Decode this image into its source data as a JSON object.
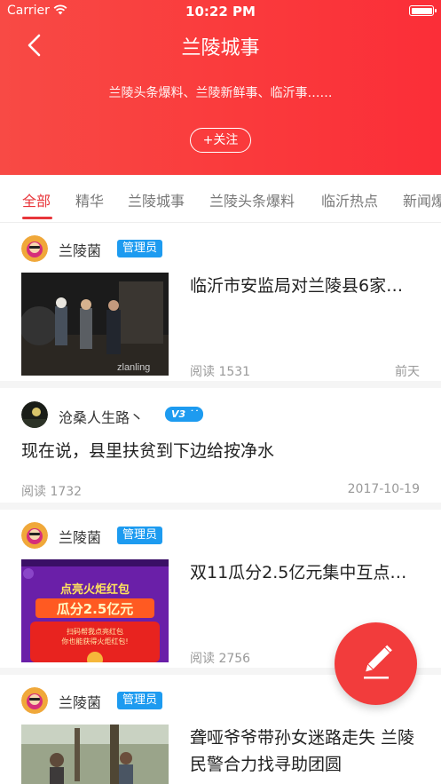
{
  "status_bar": {
    "carrier": "Carrier",
    "time": "10:22 PM"
  },
  "header": {
    "title": "兰陵城事",
    "subtitle": "兰陵头条爆料、兰陵新鲜事、临沂事……",
    "follow_label": "+关注"
  },
  "tabs": [
    "全部",
    "精华",
    "兰陵城事",
    "兰陵头条爆料",
    "临沂热点",
    "新闻爆"
  ],
  "posts": [
    {
      "author": "兰陵菌",
      "badge": "管理员",
      "title": "临沂市安监局对兰陵县6家…",
      "reads": "阅读 1531",
      "time": "前天",
      "watermark": "zlanling"
    },
    {
      "author": "沧桑人生路丶",
      "badge": "V3",
      "title": "现在说，县里扶贫到下边给按净水",
      "reads": "阅读 1732",
      "time": "2017-10-19"
    },
    {
      "author": "兰陵菌",
      "badge": "管理员",
      "title": "双11瓜分2.5亿元集中互点…",
      "reads": "阅读 2756",
      "time": "",
      "thumb_text": {
        "line1": "点亮火炬红包",
        "line2": "瓜分2.5亿元",
        "line3": "扫码帮我点亮红包",
        "line4": "你也能获得火炬红包!"
      }
    },
    {
      "author": "兰陵菌",
      "badge": "管理员",
      "title": "聋哑爷爷带孙女迷路走失 兰陵民警合力找寻助团圆"
    }
  ],
  "colors": {
    "header_red": "#fa3a3c",
    "accent": "#e8353a",
    "badge_blue": "#1d9bf0"
  },
  "icons": [
    "back-arrow-icon",
    "wifi-icon",
    "battery-icon",
    "pencil-icon"
  ]
}
